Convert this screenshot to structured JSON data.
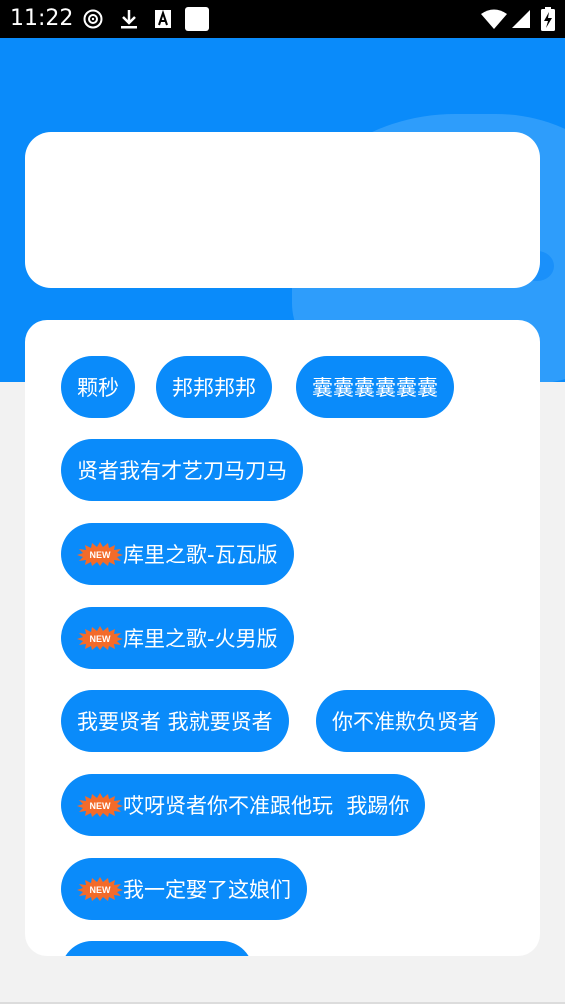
{
  "status_bar": {
    "time": "11:22",
    "icons": [
      "music-notification-icon",
      "download-icon",
      "translate-icon",
      "blank-notification-icon",
      "wifi-icon",
      "signal-icon",
      "battery-charging-icon"
    ]
  },
  "colors": {
    "accent": "#0a8bfa",
    "background": "#f2f2f2",
    "card": "#ffffff",
    "new_badge": "#f36b2a"
  },
  "new_badge_text": "NEW",
  "sound_buttons": [
    {
      "label": "颗秒",
      "is_new": false
    },
    {
      "label": "邦邦邦邦",
      "is_new": false
    },
    {
      "label": "囊囊囊囊囊囊",
      "is_new": false
    },
    {
      "label": "贤者我有才艺刀马刀马",
      "is_new": false
    },
    {
      "label": "库里之歌-瓦瓦版",
      "is_new": true
    },
    {
      "label": "库里之歌-火男版",
      "is_new": true
    },
    {
      "label": "我要贤者 我就要贤者",
      "is_new": false
    },
    {
      "label": "你不准欺负贤者",
      "is_new": false
    },
    {
      "label": "哎呀贤者你不准跟他玩  我踢你",
      "is_new": true
    },
    {
      "label": "我一定娶了这娘们",
      "is_new": true
    },
    {
      "label": "",
      "is_new": false
    }
  ]
}
